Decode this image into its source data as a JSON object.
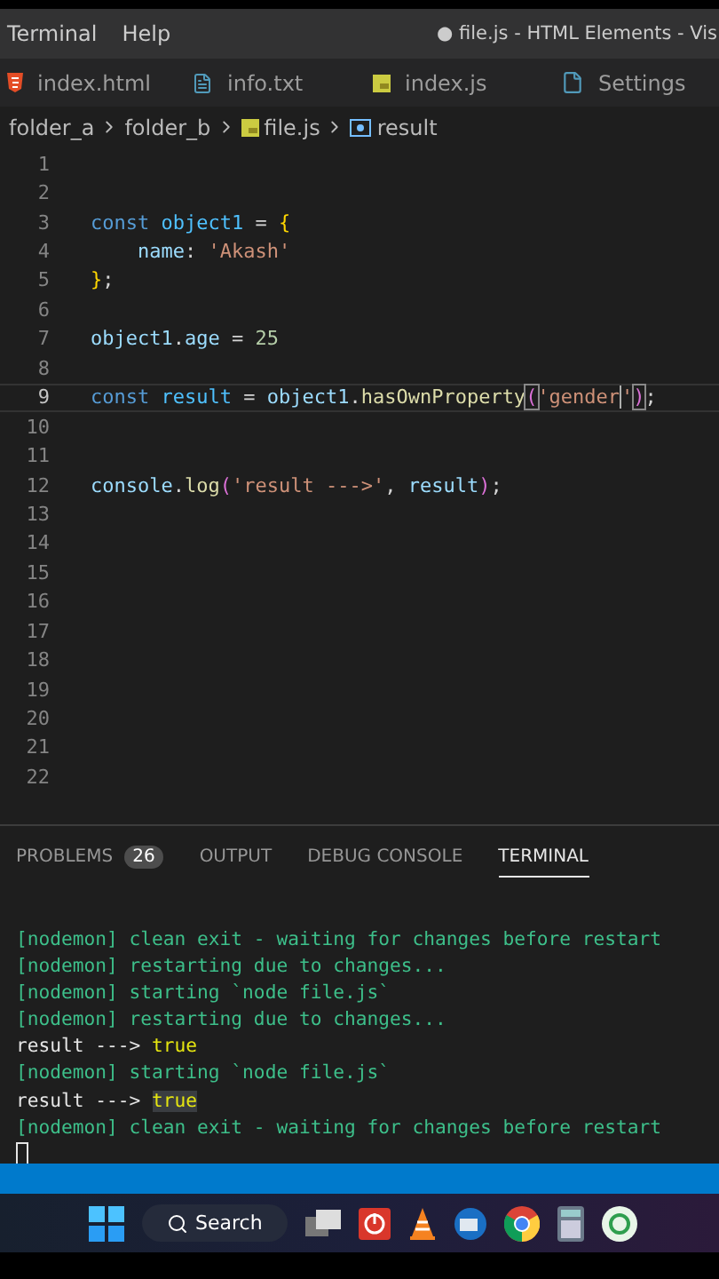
{
  "menu": {
    "items": [
      "Terminal",
      "Help"
    ],
    "title": "● file.js - HTML Elements - Vis"
  },
  "tabs": [
    {
      "label": "index.html",
      "kind": "html",
      "selected": false
    },
    {
      "label": "info.txt",
      "kind": "text",
      "selected": false
    },
    {
      "label": "index.js",
      "kind": "js",
      "selected": false
    },
    {
      "label": "Settings",
      "kind": "file",
      "selected": false
    }
  ],
  "breadcrumb": [
    {
      "label": "folder_a"
    },
    {
      "label": "folder_b"
    },
    {
      "label": "file.js",
      "kind": "js"
    },
    {
      "label": "result",
      "kind": "symbol"
    }
  ],
  "editor": {
    "lines": [
      {
        "number": "1"
      },
      {
        "number": "2"
      },
      {
        "number": "3",
        "tokens": [
          {
            "kind": "keyword",
            "text": "const"
          },
          {
            "kind": "constant",
            "text": " object1"
          },
          {
            "kind": "plain",
            "text": " = "
          },
          {
            "kind": "brace",
            "text": "{"
          }
        ]
      },
      {
        "number": "4",
        "tokens": [
          {
            "kind": "property",
            "text": "    name"
          },
          {
            "kind": "plain",
            "text": ": "
          },
          {
            "kind": "string",
            "text": "'Akash'"
          }
        ]
      },
      {
        "number": "5",
        "tokens": [
          {
            "kind": "brace",
            "text": "}"
          },
          {
            "kind": "plain",
            "text": ";"
          }
        ]
      },
      {
        "number": "6"
      },
      {
        "number": "7",
        "tokens": [
          {
            "kind": "variable",
            "text": "object1"
          },
          {
            "kind": "plain",
            "text": "."
          },
          {
            "kind": "property",
            "text": "age"
          },
          {
            "kind": "plain",
            "text": " = "
          },
          {
            "kind": "number",
            "text": "25"
          }
        ]
      },
      {
        "number": "8"
      },
      {
        "number": "9",
        "current": true,
        "tokens": [
          {
            "kind": "keyword",
            "text": "const"
          },
          {
            "kind": "constant",
            "text": " result"
          },
          {
            "kind": "plain",
            "text": " = "
          },
          {
            "kind": "variable",
            "text": "object1"
          },
          {
            "kind": "plain",
            "text": "."
          },
          {
            "kind": "function",
            "text": "hasOwnProperty"
          },
          {
            "kind": "bracket",
            "text": "(",
            "matched": true
          },
          {
            "kind": "string",
            "text": "'gender",
            "caret_after": true
          },
          {
            "kind": "string",
            "text": "'"
          },
          {
            "kind": "bracket",
            "text": ")",
            "matched": true
          },
          {
            "kind": "plain",
            "text": ";"
          }
        ]
      },
      {
        "number": "10"
      },
      {
        "number": "11"
      },
      {
        "number": "12",
        "tokens": [
          {
            "kind": "variable",
            "text": "console"
          },
          {
            "kind": "plain",
            "text": "."
          },
          {
            "kind": "function",
            "text": "log"
          },
          {
            "kind": "bracket",
            "text": "("
          },
          {
            "kind": "string",
            "text": "'result --->'"
          },
          {
            "kind": "plain",
            "text": ", "
          },
          {
            "kind": "variable",
            "text": "result"
          },
          {
            "kind": "bracket",
            "text": ")"
          },
          {
            "kind": "plain",
            "text": ";"
          }
        ]
      },
      {
        "number": "13"
      },
      {
        "number": "14"
      },
      {
        "number": "15"
      },
      {
        "number": "16"
      },
      {
        "number": "17"
      },
      {
        "number": "18"
      },
      {
        "number": "19"
      },
      {
        "number": "20"
      },
      {
        "number": "21"
      },
      {
        "number": "22"
      }
    ]
  },
  "panel": {
    "tabs": [
      {
        "label": "PROBLEMS",
        "badge": "26",
        "selected": false
      },
      {
        "label": "OUTPUT",
        "selected": false
      },
      {
        "label": "DEBUG CONSOLE",
        "selected": false
      },
      {
        "label": "TERMINAL",
        "selected": true
      }
    ],
    "terminal": [
      [
        {
          "kind": "nodemon",
          "text": "[nodemon] clean exit - waiting for changes before restart"
        }
      ],
      [
        {
          "kind": "nodemon",
          "text": "[nodemon] restarting due to changes..."
        }
      ],
      [
        {
          "kind": "nodemon",
          "text": "[nodemon] starting `node file.js`"
        }
      ],
      [
        {
          "kind": "nodemon",
          "text": "[nodemon] restarting due to changes..."
        }
      ],
      [
        {
          "kind": "plain",
          "text": "result ---> "
        },
        {
          "kind": "boolean",
          "text": "true"
        }
      ],
      [
        {
          "kind": "nodemon",
          "text": "[nodemon] starting `node file.js`"
        }
      ],
      [
        {
          "kind": "plain",
          "text": "result ---> "
        },
        {
          "kind": "boolean",
          "text": "true",
          "highlighted": true
        }
      ],
      [
        {
          "kind": "nodemon",
          "text": "[nodemon] clean exit - waiting for changes before restart"
        }
      ]
    ]
  },
  "taskbar": {
    "search": "Search"
  }
}
